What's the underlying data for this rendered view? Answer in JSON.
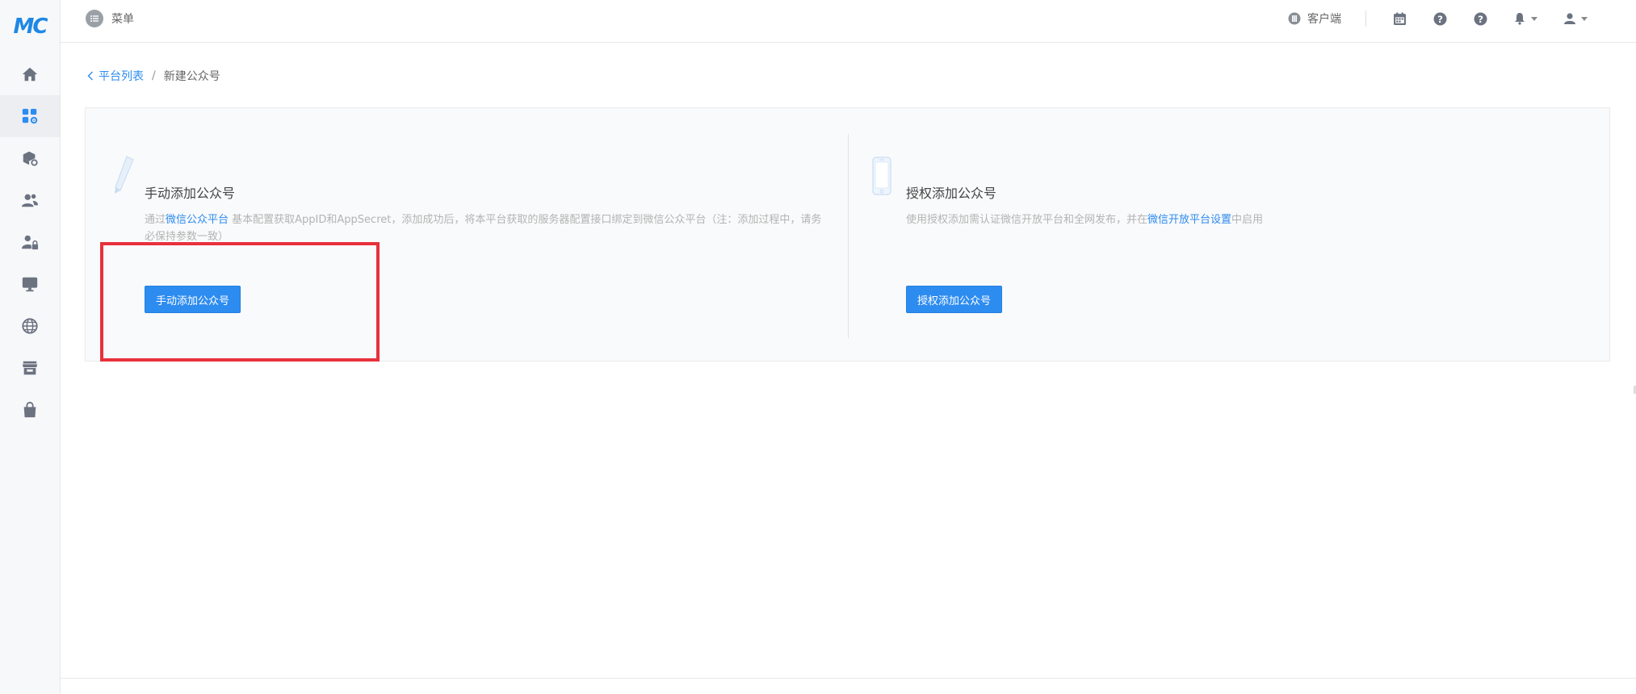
{
  "brand": {
    "logo_text": "MC",
    "accent": "#1e88e5"
  },
  "sidebar": {
    "items": [
      {
        "name": "home",
        "icon": "home-icon",
        "active": false
      },
      {
        "name": "apps",
        "icon": "apps-settings-icon",
        "active": true
      },
      {
        "name": "packages",
        "icon": "package-settings-icon",
        "active": false
      },
      {
        "name": "users",
        "icon": "users-icon",
        "active": false
      },
      {
        "name": "user-lock",
        "icon": "user-lock-icon",
        "active": false
      },
      {
        "name": "monitor",
        "icon": "monitor-icon",
        "active": false
      },
      {
        "name": "globe",
        "icon": "globe-icon",
        "active": false
      },
      {
        "name": "store",
        "icon": "store-icon",
        "active": false
      },
      {
        "name": "bag",
        "icon": "shopping-bag-icon",
        "active": false
      }
    ]
  },
  "header": {
    "menu_label": "菜单",
    "client_label": "客户端",
    "icons": [
      "calendar-icon",
      "help-icon",
      "help-icon",
      "bell-icon",
      "user-icon"
    ]
  },
  "breadcrumb": {
    "back_label": "平台列表",
    "separator": "/",
    "current": "新建公众号"
  },
  "manual_card": {
    "icon": "pencil-icon",
    "title": "手动添加公众号",
    "desc_prefix": "通过",
    "desc_link": "微信公众平台",
    "desc_suffix": " 基本配置获取AppID和AppSecret，添加成功后，将本平台获取的服务器配置接口绑定到微信公众平台（注：添加过程中，请务必保持参数一致）",
    "button_label": "手动添加公众号"
  },
  "auth_card": {
    "icon": "phone-icon",
    "title": "授权添加公众号",
    "desc_prefix": "使用授权添加需认证微信开放平台和全网发布，并在",
    "desc_link": "微信开放平台设置",
    "desc_suffix": "中启用",
    "button_label": "授权添加公众号"
  },
  "colors": {
    "primary": "#2d8cf0",
    "highlight": "#e8313b"
  }
}
